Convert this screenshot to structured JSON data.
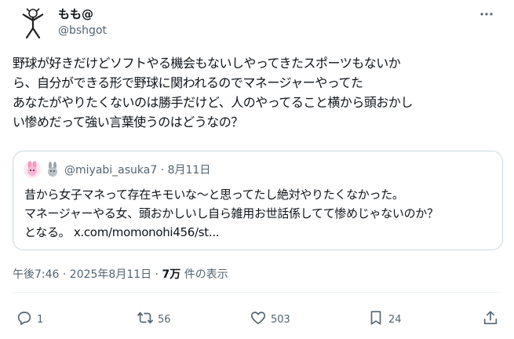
{
  "author": {
    "display_name": "もも@",
    "handle": "@bshgot"
  },
  "icons": {
    "more": "more-horizontal-icon",
    "reply": "reply-icon",
    "retweet": "retweet-icon",
    "like": "heart-icon",
    "bookmark": "bookmark-icon",
    "share": "share-icon"
  },
  "post": {
    "lines": [
      "野球が好きだけどソフトやる機会もないしやってきたスポーツもないか",
      "ら、自分ができる形で野球に関われるのでマネージャーやってた",
      "あなたがやりたくないのは勝手だけど、人のやってること横から頭おかし",
      "い惨めだって強い言葉使うのはどうなの？"
    ]
  },
  "quote": {
    "handle_date": "@miyabi_asuka7 · 8月11日",
    "lines": [
      "昔から女子マネって存在キモいな～と思ってたし絶対やりたくなかった。",
      "マネージャーやる女、頭おかしいし自ら雑用お世話係してて惨めじゃないのか？",
      "となる。 x.com/momonohi456/st..."
    ]
  },
  "meta": {
    "time_date": "午後7:46 · 2025年8月11日 · ",
    "views": "7万",
    "views_suffix": " 件の表示"
  },
  "actions": {
    "replies": "1",
    "retweets": "56",
    "likes": "503",
    "bookmarks": "24"
  },
  "colors": {
    "text": "#0f1419",
    "secondary": "#536471",
    "border": "#cfd9de"
  }
}
